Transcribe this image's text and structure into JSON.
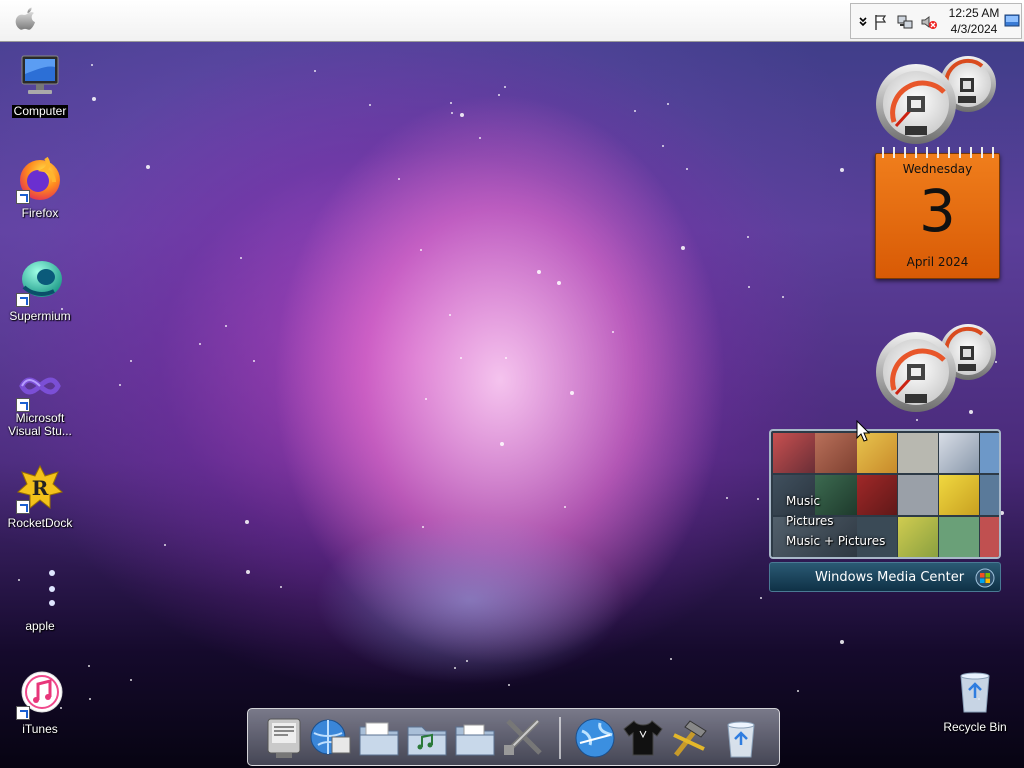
{
  "clock": {
    "time": "12:25 AM",
    "date": "4/3/2024"
  },
  "desktop_icons": [
    {
      "label": "Computer",
      "icon": "computer-monitor-icon"
    },
    {
      "label": "Firefox",
      "icon": "firefox-icon"
    },
    {
      "label": "Supermium",
      "icon": "supermium-icon"
    },
    {
      "label": "Microsoft Visual Stu...",
      "icon": "visual-studio-icon"
    },
    {
      "label": "RocketDock",
      "icon": "rocketdock-icon"
    },
    {
      "label": "apple",
      "icon": "apple-dots-icon"
    },
    {
      "label": "iTunes",
      "icon": "itunes-icon"
    },
    {
      "label": "Recycle Bin",
      "icon": "recycle-bin-icon"
    }
  ],
  "calendar": {
    "weekday": "Wednesday",
    "day": "3",
    "month_year": "April 2024"
  },
  "media_center": {
    "menu": [
      "Music",
      "Pictures",
      "Music + Pictures"
    ],
    "title": "Windows Media Center"
  },
  "dock_items": [
    "system-preferences-icon",
    "network-icon",
    "documents-folder-icon",
    "music-folder-icon",
    "pictures-folder-icon",
    "utilities-icon",
    "internet-globe-icon",
    "shirt-icon",
    "hammer-tools-icon",
    "trash-icon"
  ],
  "colors": {
    "calendar_orange": "#e86a0e",
    "menubar": "#f3f3f3",
    "wmc_bar": "#1d4660"
  }
}
